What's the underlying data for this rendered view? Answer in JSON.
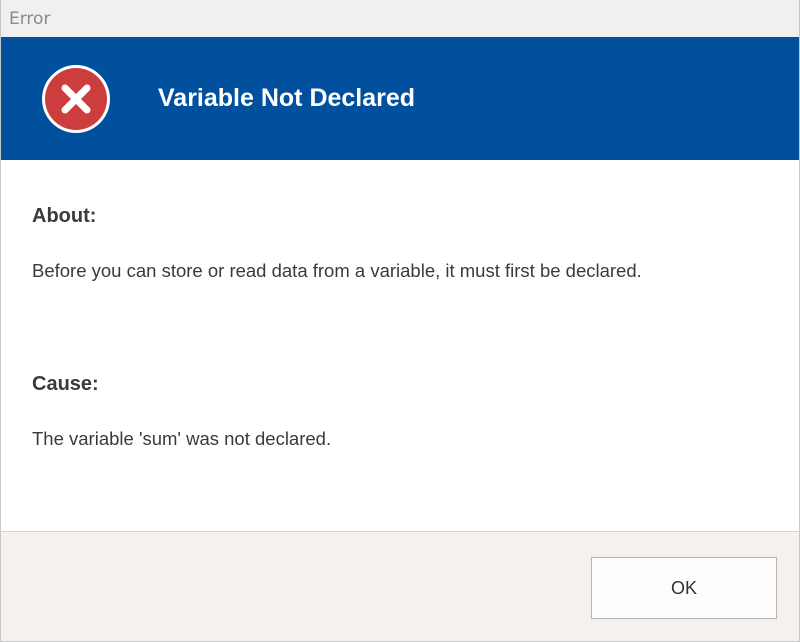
{
  "window": {
    "title": "Error"
  },
  "banner": {
    "icon": "error-x-circle-icon",
    "title": "Variable Not Declared",
    "background_color": "#00509e",
    "icon_color": "#cc3d3d"
  },
  "content": {
    "about_heading": "About:",
    "about_text": "Before you can store or read data from a variable, it must first be declared.",
    "cause_heading": "Cause:",
    "cause_text": "The variable 'sum' was not declared."
  },
  "footer": {
    "ok_label": "OK"
  }
}
